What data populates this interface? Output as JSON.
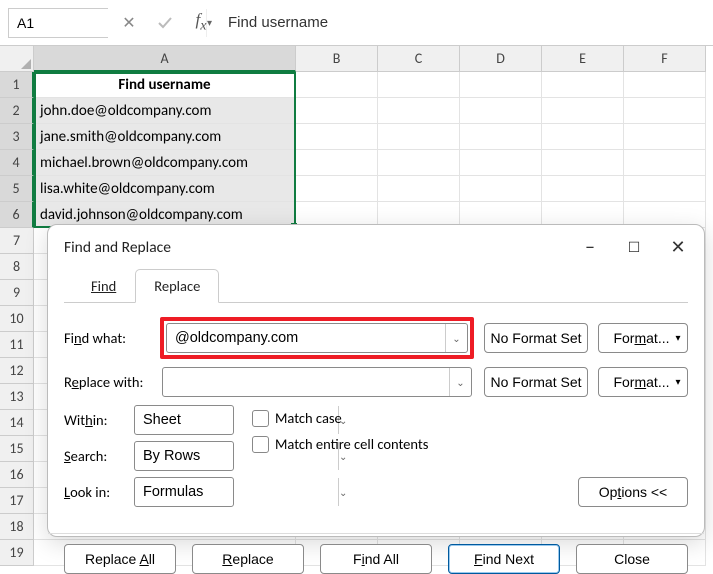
{
  "namebox": {
    "value": "A1"
  },
  "formula_bar": {
    "value": "Find username"
  },
  "columns": [
    "A",
    "B",
    "C",
    "D",
    "E",
    "F"
  ],
  "rows": [
    1,
    2,
    3,
    4,
    5,
    6,
    7,
    8,
    9,
    10,
    11,
    12,
    13,
    14,
    15,
    16,
    17,
    18,
    19
  ],
  "sheet": {
    "header_cell": "Find username",
    "data": [
      "john.doe@oldcompany.com",
      "jane.smith@oldcompany.com",
      "michael.brown@oldcompany.com",
      "lisa.white@oldcompany.com",
      "david.johnson@oldcompany.com"
    ]
  },
  "dialog": {
    "title": "Find and Replace",
    "tab_find": "Find",
    "tab_replace": "Replace",
    "find_label_pre": "Fi",
    "find_label_u": "n",
    "find_label_post": "d what:",
    "replace_label_pre": "R",
    "replace_label_u": "e",
    "replace_label_post": "place with:",
    "find_value": "@oldcompany.com",
    "replace_value": "",
    "no_format": "No Format Set",
    "format_pre": "For",
    "format_u": "m",
    "format_post": "at...",
    "within_label_pre": "Wit",
    "within_label_u": "h",
    "within_label_post": "in:",
    "within_value": "Sheet",
    "search_label_u": "S",
    "search_label_post": "earch:",
    "search_value": "By Rows",
    "lookin_label_u": "L",
    "lookin_label_post": "ook in:",
    "lookin_value": "Formulas",
    "match_case_pre": "Match ",
    "match_case_u": "c",
    "match_case_post": "ase",
    "match_entire_pre": "Match entire cell c",
    "match_entire_u": "o",
    "match_entire_post": "ntents",
    "options_pre": "Op",
    "options_u": "t",
    "options_post": "ions <<",
    "btn_replace_all_pre": "Replace ",
    "btn_replace_all_u": "A",
    "btn_replace_all_post": "ll",
    "btn_replace_u": "R",
    "btn_replace_post": "eplace",
    "btn_find_all_pre": "F",
    "btn_find_all_u": "i",
    "btn_find_all_post": "nd All",
    "btn_find_next_u": "F",
    "btn_find_next_post": "ind Next",
    "btn_close": "Close"
  }
}
